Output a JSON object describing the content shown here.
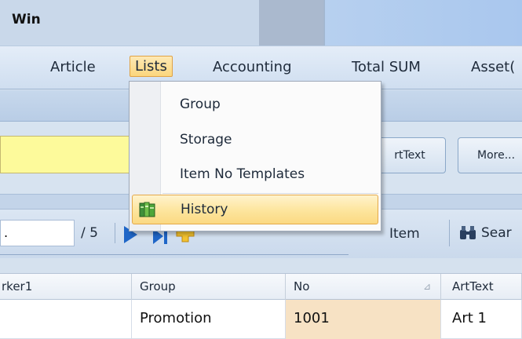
{
  "window": {
    "title": "Win"
  },
  "menubar": {
    "items": [
      "Article",
      "Lists",
      "Accounting",
      "Total SUM",
      "Asset("
    ]
  },
  "toolbar": {
    "arttext_button": "rtText",
    "more_button": "More..."
  },
  "navigator": {
    "record_value": ".",
    "total": "/ 5",
    "item_label": "Item",
    "search_label": "Sear"
  },
  "grid": {
    "columns": [
      "rker1",
      "Group",
      "No",
      "ArtText"
    ],
    "sort_indicator": "⊿",
    "row": {
      "marker1": "",
      "group": "Promotion",
      "no": "1001",
      "arttext": "Art 1"
    }
  },
  "dropdown": {
    "items": [
      "Group",
      "Storage",
      "Item No Templates",
      "History"
    ]
  },
  "colors": {
    "menu_highlight": "#fbd67d",
    "selected_cell": "#f7e2c4",
    "yellow_field": "#fdfa9b"
  },
  "icons": {
    "history": "book-stack-icon",
    "next": "next-record-icon",
    "last": "last-record-icon",
    "add": "add-record-icon",
    "search": "binoculars-icon"
  }
}
